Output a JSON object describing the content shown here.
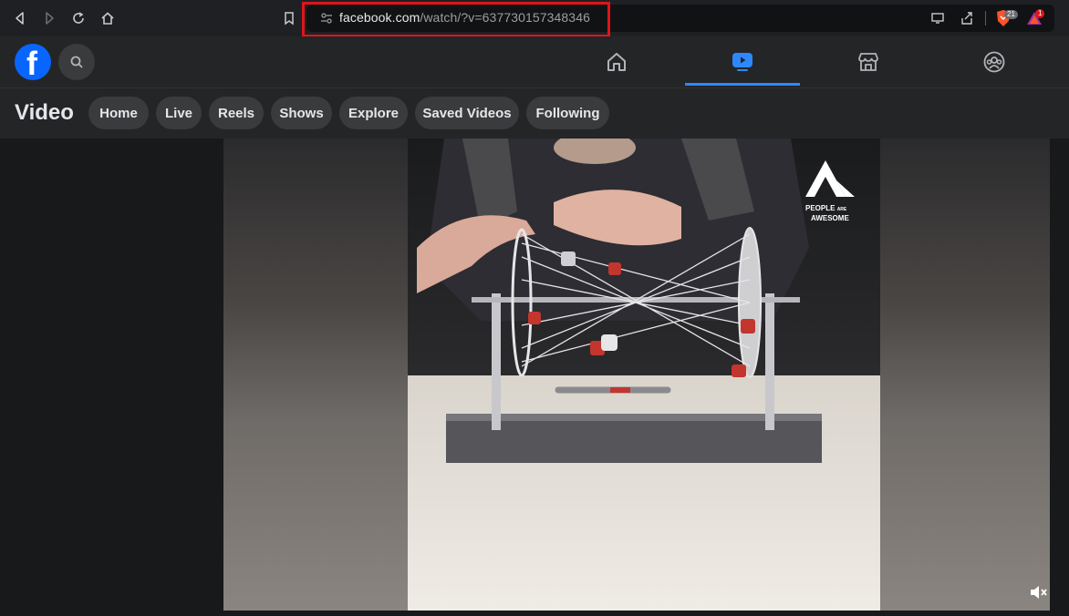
{
  "browser": {
    "url_host": "facebook.com",
    "url_path": "/watch/?v=637730157348346",
    "brave_count": "21",
    "rewards_count": "1"
  },
  "header": {
    "logo": "f"
  },
  "subnav": {
    "title": "Video",
    "pills": [
      "Home",
      "Live",
      "Reels",
      "Shows",
      "Explore",
      "Saved Videos",
      "Following"
    ]
  },
  "video": {
    "watermark_line1": "PEOPLE",
    "watermark_are": "ARE",
    "watermark_line2": "AWESOME"
  },
  "colors": {
    "accent": "#2d88ff",
    "fb_blue": "#0866ff",
    "highlight": "#e0141b"
  }
}
